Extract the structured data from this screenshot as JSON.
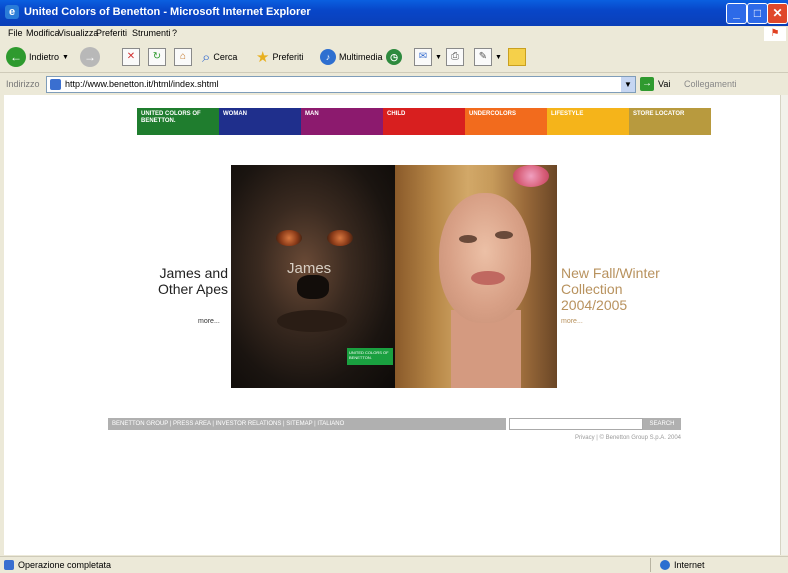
{
  "window": {
    "title": "United Colors of Benetton - Microsoft Internet Explorer",
    "minimize": "_",
    "maximize": "□",
    "close": "✕"
  },
  "menu": [
    "File",
    "Modifica",
    "Visualizza",
    "Preferiti",
    "Strumenti",
    "?"
  ],
  "toolbar": {
    "back_label": "Indietro",
    "search_label": "Cerca",
    "favorites_label": "Preferiti",
    "media_label": "Multimedia"
  },
  "address": {
    "label": "Indirizzo",
    "url": "http://www.benetton.it/html/index.shtml",
    "go_label": "Vai",
    "links_label": "Collegamenti"
  },
  "nav": {
    "tabs": [
      {
        "label": "UNITED COLORS OF BENETTON.",
        "color": "#1f7d2e"
      },
      {
        "label": "WOMAN",
        "color": "#1f2f8c"
      },
      {
        "label": "MAN",
        "color": "#8c1a6e"
      },
      {
        "label": "CHILD",
        "color": "#d81f1f"
      },
      {
        "label": "UNDERCOLORS",
        "color": "#f26b1d"
      },
      {
        "label": "LIFESTYLE",
        "color": "#f5b41a"
      },
      {
        "label": "STORE LOCATOR",
        "color": "#b89a3e"
      }
    ]
  },
  "left_promo": {
    "line1": "James and",
    "line2": "Other Apes",
    "more": "more...",
    "image_title": "James",
    "label": "UNITED COLORS OF BENETTON."
  },
  "right_promo": {
    "line1": "New Fall/Winter",
    "line2": "Collection",
    "line3": "2004/2005",
    "more": "more..."
  },
  "footer": {
    "links": "BENETTON GROUP | PRESS AREA | INVESTOR RELATIONS | SITEMAP | ITALIANO",
    "search_button": "SEARCH",
    "copyright": "Privacy | © Benetton Group S.p.A. 2004"
  },
  "status": {
    "text": "Operazione completata",
    "zone": "Internet"
  }
}
